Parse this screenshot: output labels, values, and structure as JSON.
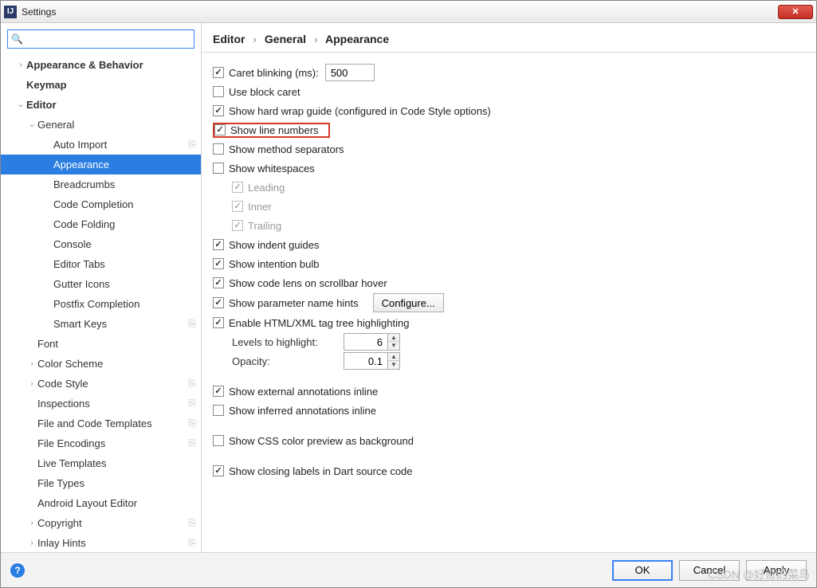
{
  "window": {
    "title": "Settings"
  },
  "search": {
    "placeholder": "",
    "value": ""
  },
  "tree": {
    "appearance_behavior": "Appearance & Behavior",
    "keymap": "Keymap",
    "editor": "Editor",
    "general": "General",
    "auto_import": "Auto Import",
    "appearance": "Appearance",
    "breadcrumbs": "Breadcrumbs",
    "code_completion": "Code Completion",
    "code_folding": "Code Folding",
    "console": "Console",
    "editor_tabs": "Editor Tabs",
    "gutter_icons": "Gutter Icons",
    "postfix_completion": "Postfix Completion",
    "smart_keys": "Smart Keys",
    "font": "Font",
    "color_scheme": "Color Scheme",
    "code_style": "Code Style",
    "inspections": "Inspections",
    "file_code_templates": "File and Code Templates",
    "file_encodings": "File Encodings",
    "live_templates": "Live Templates",
    "file_types": "File Types",
    "android_layout_editor": "Android Layout Editor",
    "copyright": "Copyright",
    "inlay_hints": "Inlay Hints"
  },
  "breadcrumb": {
    "a": "Editor",
    "b": "General",
    "c": "Appearance"
  },
  "opts": {
    "caret_blinking_label": "Caret blinking (ms):",
    "caret_blinking_value": "500",
    "use_block_caret": "Use block caret",
    "show_hard_wrap": "Show hard wrap guide (configured in Code Style options)",
    "show_line_numbers": "Show line numbers",
    "show_method_separators": "Show method separators",
    "show_whitespaces": "Show whitespaces",
    "ws_leading": "Leading",
    "ws_inner": "Inner",
    "ws_trailing": "Trailing",
    "show_indent_guides": "Show indent guides",
    "show_intention_bulb": "Show intention bulb",
    "show_code_lens": "Show code lens on scrollbar hover",
    "show_param_hints": "Show parameter name hints",
    "configure_btn": "Configure...",
    "enable_html_xml": "Enable HTML/XML tag tree highlighting",
    "levels_label": "Levels to highlight:",
    "levels_value": "6",
    "opacity_label": "Opacity:",
    "opacity_value": "0.1",
    "show_ext_annotations": "Show external annotations inline",
    "show_inferred_annotations": "Show inferred annotations inline",
    "show_css_preview": "Show CSS color preview as background",
    "show_closing_labels": "Show closing labels in Dart source code"
  },
  "footer": {
    "ok": "OK",
    "cancel": "Cancel",
    "apply": "Apply"
  },
  "watermark": "CSDN @好奇的菜鸟"
}
